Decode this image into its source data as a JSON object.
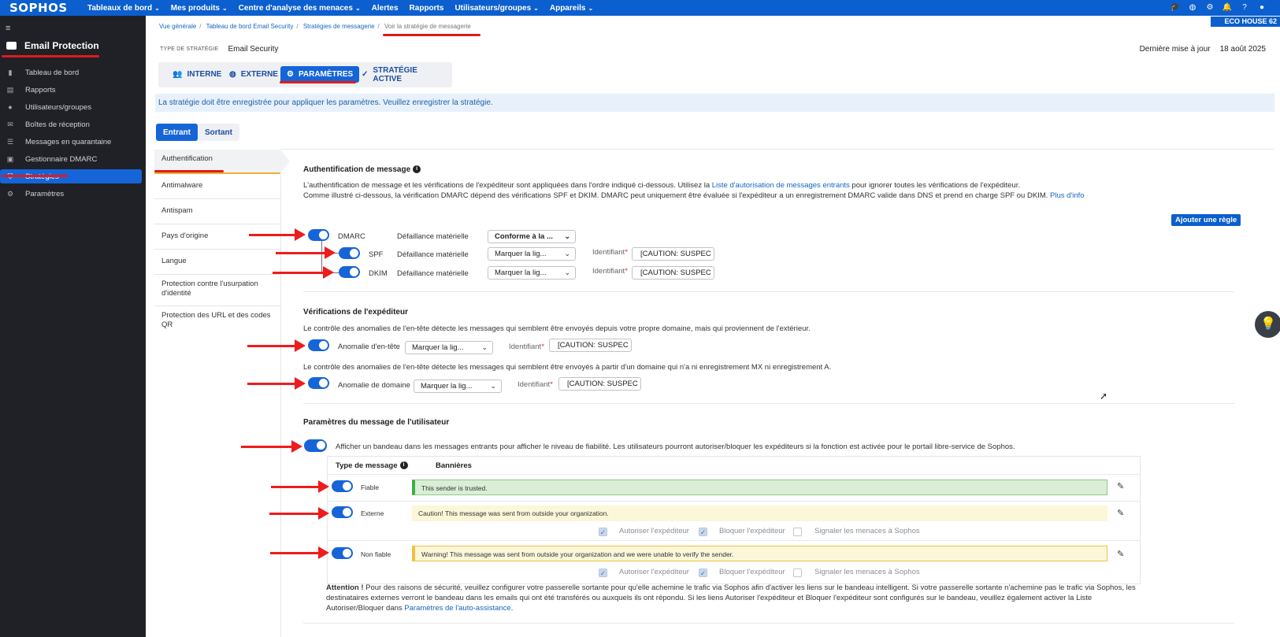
{
  "header": {
    "logo": "SOPHOS",
    "nav": [
      {
        "label": "Tableaux de bord",
        "chevron": true
      },
      {
        "label": "Mes produits",
        "chevron": true
      },
      {
        "label": "Centre d'analyse des menaces",
        "chevron": true
      },
      {
        "label": "Alertes",
        "chevron": false
      },
      {
        "label": "Rapports",
        "chevron": false
      },
      {
        "label": "Utilisateurs/groupes",
        "chevron": true
      },
      {
        "label": "Appareils",
        "chevron": true
      }
    ],
    "icons": [
      "graduation-cap-icon",
      "globe-icon",
      "gear-icon",
      "bell-icon",
      "help-icon",
      "user-icon"
    ],
    "tenant": "ECO HOUSE 62"
  },
  "sidebar": {
    "title": "Email Protection",
    "items": [
      {
        "label": "Tableau de bord",
        "icon": "bar-chart-icon"
      },
      {
        "label": "Rapports",
        "icon": "report-icon"
      },
      {
        "label": "Utilisateurs/groupes",
        "icon": "users-icon"
      },
      {
        "label": "Boîtes de réception",
        "icon": "mailbox-icon"
      },
      {
        "label": "Messages en quarantaine",
        "icon": "list-icon"
      },
      {
        "label": "Gestionnaire DMARC",
        "icon": "dmarc-icon"
      },
      {
        "label": "Stratégies",
        "icon": "shield-icon",
        "active": true
      },
      {
        "label": "Paramètres",
        "icon": "gear-icon"
      }
    ]
  },
  "breadcrumb": [
    "Vue générale",
    "Tableau de bord Email Security",
    "Stratégies de messagerie",
    "Voir la stratégie de messagerie"
  ],
  "policy_type": {
    "label": "TYPE DE STRATÉGIE",
    "value": "Email Security"
  },
  "last_update": {
    "label": "Dernière mise à jour",
    "value": "18 août 2025"
  },
  "tabs": [
    {
      "label": "INTERNE",
      "icon": "users-icon"
    },
    {
      "label": "EXTERNE",
      "icon": "globe-icon"
    },
    {
      "label": "PARAMÈTRES",
      "icon": "gear-icon",
      "active": true
    },
    {
      "label": "STRATÉGIE ACTIVE",
      "icon": "check-icon"
    }
  ],
  "notice": "La stratégie doit être enregistrée pour appliquer les paramètres. Veuillez enregistrer la stratégie.",
  "direction": {
    "inbound": "Entrant",
    "outbound": "Sortant",
    "active": "Entrant"
  },
  "menu": [
    "Authentification",
    "Antimalware",
    "Antispam",
    "Pays d'origine",
    "Langue",
    "Protection contre l'usurpation d'identité",
    "Protection des URL et des codes QR"
  ],
  "auth": {
    "title": "Authentification de message",
    "desc1_a": "L'authentification de message et les vérifications de l'expéditeur sont appliquées dans l'ordre indiqué ci-dessous. Utilisez la ",
    "desc1_link": "Liste d'autorisation de messages entrants",
    "desc1_b": " pour ignorer toutes les vérifications de l'expéditeur.",
    "desc2": "Comme illustré ci-dessous, la vérification DMARC dépend des vérifications SPF et DKIM. DMARC peut uniquement être évaluée si l'expéditeur a un enregistrement DMARC valide dans DNS et prend en charge SPF ou DKIM.",
    "desc2_link": "Plus d'info",
    "add_rule": "Ajouter une règle",
    "rows": [
      {
        "name": "DMARC",
        "failure": "Défaillance matérielle",
        "action": "Conforme à la ..."
      },
      {
        "name": "SPF",
        "failure": "Défaillance matérielle",
        "action": "Marquer la lig...",
        "id_label": "Identifiant",
        "id_value": "[CAUTION: SUSPEC"
      },
      {
        "name": "DKIM",
        "failure": "Défaillance matérielle",
        "action": "Marquer la lig...",
        "id_label": "Identifiant",
        "id_value": "[CAUTION: SUSPEC"
      }
    ]
  },
  "sender": {
    "title": "Vérifications de l'expéditeur",
    "desc1": "Le contrôle des anomalies de l'en-tête détecte les messages qui semblent être envoyés depuis votre propre domaine, mais qui proviennent de l'extérieur.",
    "header_anomaly": {
      "label": "Anomalie d'en-tête",
      "action": "Marquer la lig...",
      "id_label": "Identifiant",
      "id_value": "[CAUTION: SUSPEC"
    },
    "desc2": "Le contrôle des anomalies de l'en-tête détecte les messages qui semblent être envoyés à partir d'un domaine qui n'a ni enregistrement MX ni enregistrement A.",
    "domain_anomaly": {
      "label": "Anomalie de domaine",
      "action": "Marquer la lig...",
      "id_label": "Identifiant",
      "id_value": "[CAUTION: SUSPEC"
    }
  },
  "user_msg": {
    "title": "Paramètres du message de l'utilisateur",
    "banner_toggle": "Afficher un bandeau dans les messages entrants pour afficher le niveau de fiabilité. Les utilisateurs pourront autoriser/bloquer les expéditeurs si la fonction est activée pour le portail libre-service de Sophos.",
    "col_type": "Type de message",
    "col_banners": "Bannières",
    "rows": [
      {
        "type": "Fiable",
        "text": "This sender is trusted."
      },
      {
        "type": "Externe",
        "text": "Caution! This message was sent from outside your organization."
      },
      {
        "type": "Non fiable",
        "text": "Warning! This message was sent from outside your organization and we were unable to verify the sender."
      }
    ],
    "options": {
      "allow": "Autoriser l'expéditeur",
      "block": "Bloquer l'expéditeur",
      "report": "Signaler les menaces à Sophos"
    },
    "warning_bold": "Attention !",
    "warning_l1": " Pour des raisons de sécurité, veuillez configurer votre passerelle sortante pour qu'elle achemine le trafic via Sophos afin d'activer les liens sur le bandeau intelligent. Si votre passerelle sortante n'achemine pas le trafic via Sophos, les",
    "warning_l2": "destinataires externes verront le bandeau dans les emails qui ont été transférés ou auxquels ils ont répondu. Si les liens Autoriser l'expéditeur et Bloquer l'expéditeur sont configurés sur le bandeau, veuillez également activer la Liste",
    "warning_l3": "Autoriser/Bloquer dans ",
    "warning_link": "Paramètres de l'auto-assistance",
    "warning_end": "."
  },
  "colors": {
    "brand": "#0b5fce",
    "accent": "#1565d8",
    "annotation": "#ee1c1c"
  }
}
